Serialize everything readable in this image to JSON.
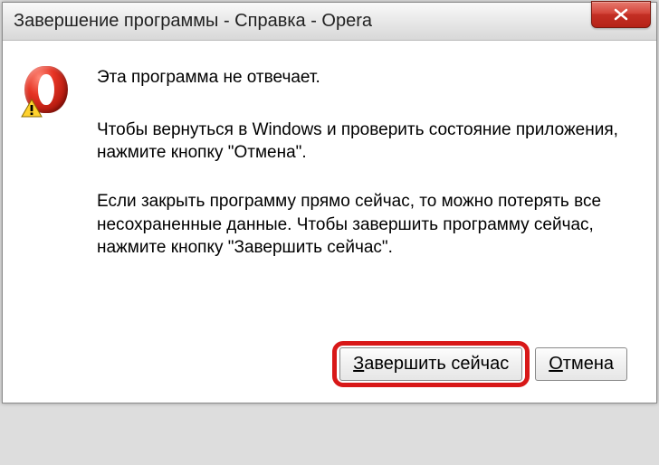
{
  "titlebar": {
    "title": "Завершение программы - Справка - Opera"
  },
  "message": {
    "heading": "Эта программа не отвечает.",
    "para1": "Чтобы вернуться в Windows и проверить состояние приложения, нажмите кнопку \"Отмена\".",
    "para2": "Если закрыть программу прямо сейчас, то можно потерять все несохраненные данные. Чтобы завершить программу сейчас, нажмите кнопку \"Завершить сейчас\"."
  },
  "buttons": {
    "end_now_prefix": "З",
    "end_now_rest": "авершить сейчас",
    "cancel_prefix": "О",
    "cancel_rest": "тмена"
  },
  "icons": {
    "app": "opera-icon",
    "warn": "warning-overlay-icon",
    "close": "close-x-icon"
  },
  "colors": {
    "highlight": "#d81818",
    "close_bg": "#c32f24",
    "opera_red": "#e63424"
  }
}
